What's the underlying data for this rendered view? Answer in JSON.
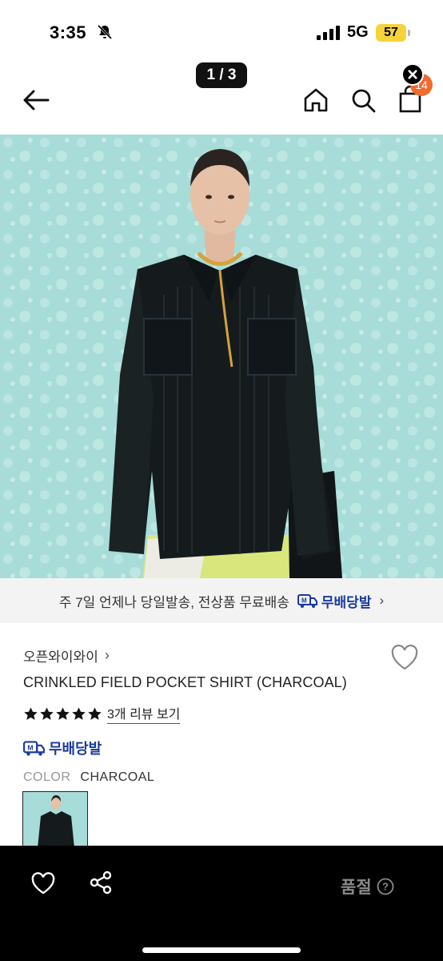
{
  "status_bar": {
    "time": "3:35",
    "network": "5G",
    "battery": "57"
  },
  "nav": {
    "page_indicator": "1 / 3",
    "cart_count": "14"
  },
  "shipping_banner": {
    "text": "주 7일 언제나 당일발송, 전상품 무료배송",
    "badge": "무배당발"
  },
  "product": {
    "shop_name": "오픈와이와이",
    "title": "CRINKLED FIELD POCKET SHIRT (CHARCOAL)",
    "rating_stars": 5,
    "review_link": "3개 리뷰 보기",
    "free_badge": "무배당발",
    "color_label": "COLOR",
    "color_value": "CHARCOAL"
  },
  "bottom_bar": {
    "status": "품절"
  },
  "colors": {
    "accent_blue": "#1a3a9c",
    "badge_orange": "#f26a2e",
    "battery_yellow": "#f5d33a",
    "image_bg": "#a7dcd8"
  }
}
